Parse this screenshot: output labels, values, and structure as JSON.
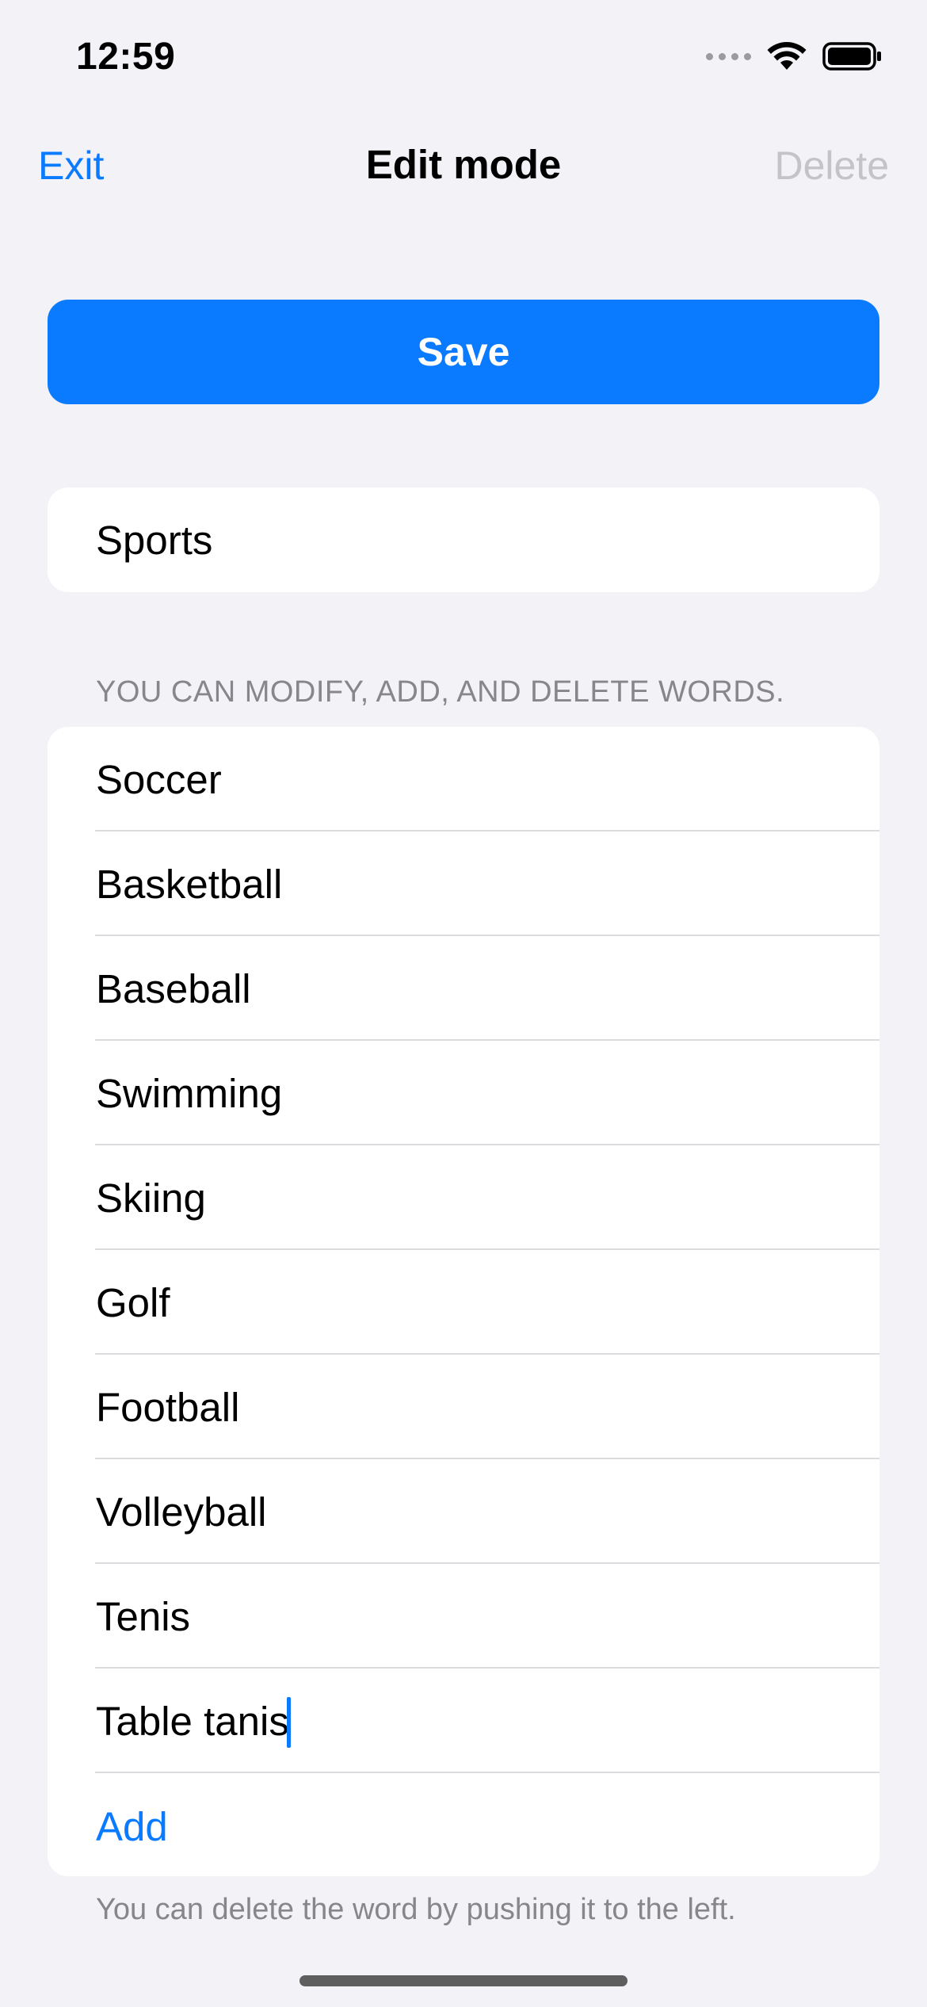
{
  "status_bar": {
    "time": "12:59",
    "icons": [
      "cellular-signal-icon",
      "wifi-icon",
      "battery-icon"
    ]
  },
  "nav": {
    "left_action": "Exit",
    "title": "Edit mode",
    "right_action": "Delete",
    "right_action_enabled": false
  },
  "save_label": "Save",
  "category": {
    "value": "Sports"
  },
  "section_header": "YOU CAN MODIFY, ADD, AND DELETE WORDS.",
  "words": [
    "Soccer",
    "Basketball",
    "Baseball",
    "Swimming",
    "Skiing",
    "Golf",
    "Football",
    "Volleyball",
    "Tenis",
    "Table tanis"
  ],
  "focused_word_index": 9,
  "add_label": "Add",
  "footer_hint": "You can delete the word by pushing it to the left.",
  "colors": {
    "accent": "#0a7aff",
    "background": "#f2f2f7",
    "secondary_text": "#86868b",
    "disabled_text": "#c4c4c7"
  }
}
